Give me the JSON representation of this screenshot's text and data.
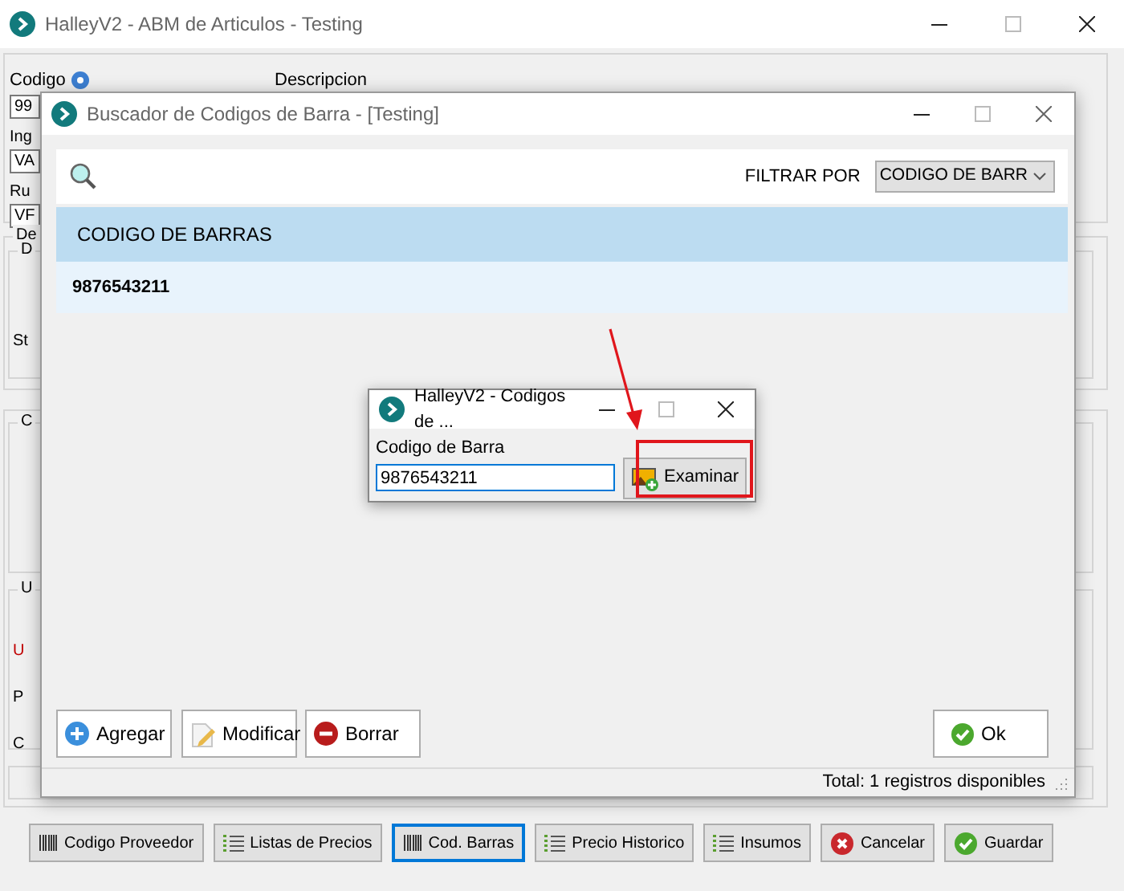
{
  "main_window": {
    "title": "HalleyV2 - ABM de Articulos - Testing",
    "form": {
      "codigo_label": "Codigo",
      "codigo_value": "99",
      "descripcion_label": "Descripcion",
      "fragments": [
        {
          "kind": "label",
          "text": "Ing"
        },
        {
          "kind": "field",
          "text": "VA"
        },
        {
          "kind": "label",
          "text": "Ru"
        },
        {
          "kind": "field",
          "text": "VF"
        }
      ],
      "groups": [
        {
          "legend": "De",
          "children": [
            {
              "legend": "D",
              "texts": [
                {
                  "kind": "label",
                  "text": "St"
                }
              ]
            }
          ]
        },
        {
          "children": [
            {
              "legend": "C"
            },
            {
              "legend": "U",
              "texts": [
                {
                  "kind": "alert-label",
                  "text": "U"
                },
                {
                  "kind": "label",
                  "text": "P"
                },
                {
                  "kind": "label",
                  "text": "C"
                }
              ]
            }
          ]
        }
      ]
    },
    "buttons": [
      {
        "kind": "barcode",
        "label": "Codigo Proveedor",
        "focused": false
      },
      {
        "kind": "list",
        "label": "Listas de Precios",
        "focused": false
      },
      {
        "kind": "barcode",
        "label": "Cod. Barras",
        "focused": true
      },
      {
        "kind": "list",
        "label": "Precio Historico",
        "focused": false
      },
      {
        "kind": "list",
        "label": "Insumos",
        "focused": false
      },
      {
        "kind": "cancel",
        "label": "Cancelar",
        "focused": false
      },
      {
        "kind": "check",
        "label": "Guardar",
        "focused": false
      }
    ]
  },
  "search_dialog": {
    "title": "Buscador de Codigos de Barra - [Testing]",
    "filter_label": "FILTRAR POR",
    "filter_value": "CODIGO DE BARR",
    "table": {
      "columns": [
        "CODIGO DE BARRAS"
      ],
      "rows": [
        [
          "9876543211"
        ]
      ]
    },
    "buttons": [
      {
        "kind": "add",
        "label": "Agregar"
      },
      {
        "kind": "edit",
        "label": "Modificar"
      },
      {
        "kind": "delete",
        "label": "Borrar"
      }
    ],
    "ok_button": {
      "kind": "check",
      "label": "Ok"
    },
    "status": "Total: 1 registros disponibles"
  },
  "barcode_dialog": {
    "title": "HalleyV2 - Codigos de ...",
    "label": "Codigo de Barra",
    "value": "9876543211",
    "button": {
      "kind": "image-add",
      "label": "Examinar"
    }
  }
}
